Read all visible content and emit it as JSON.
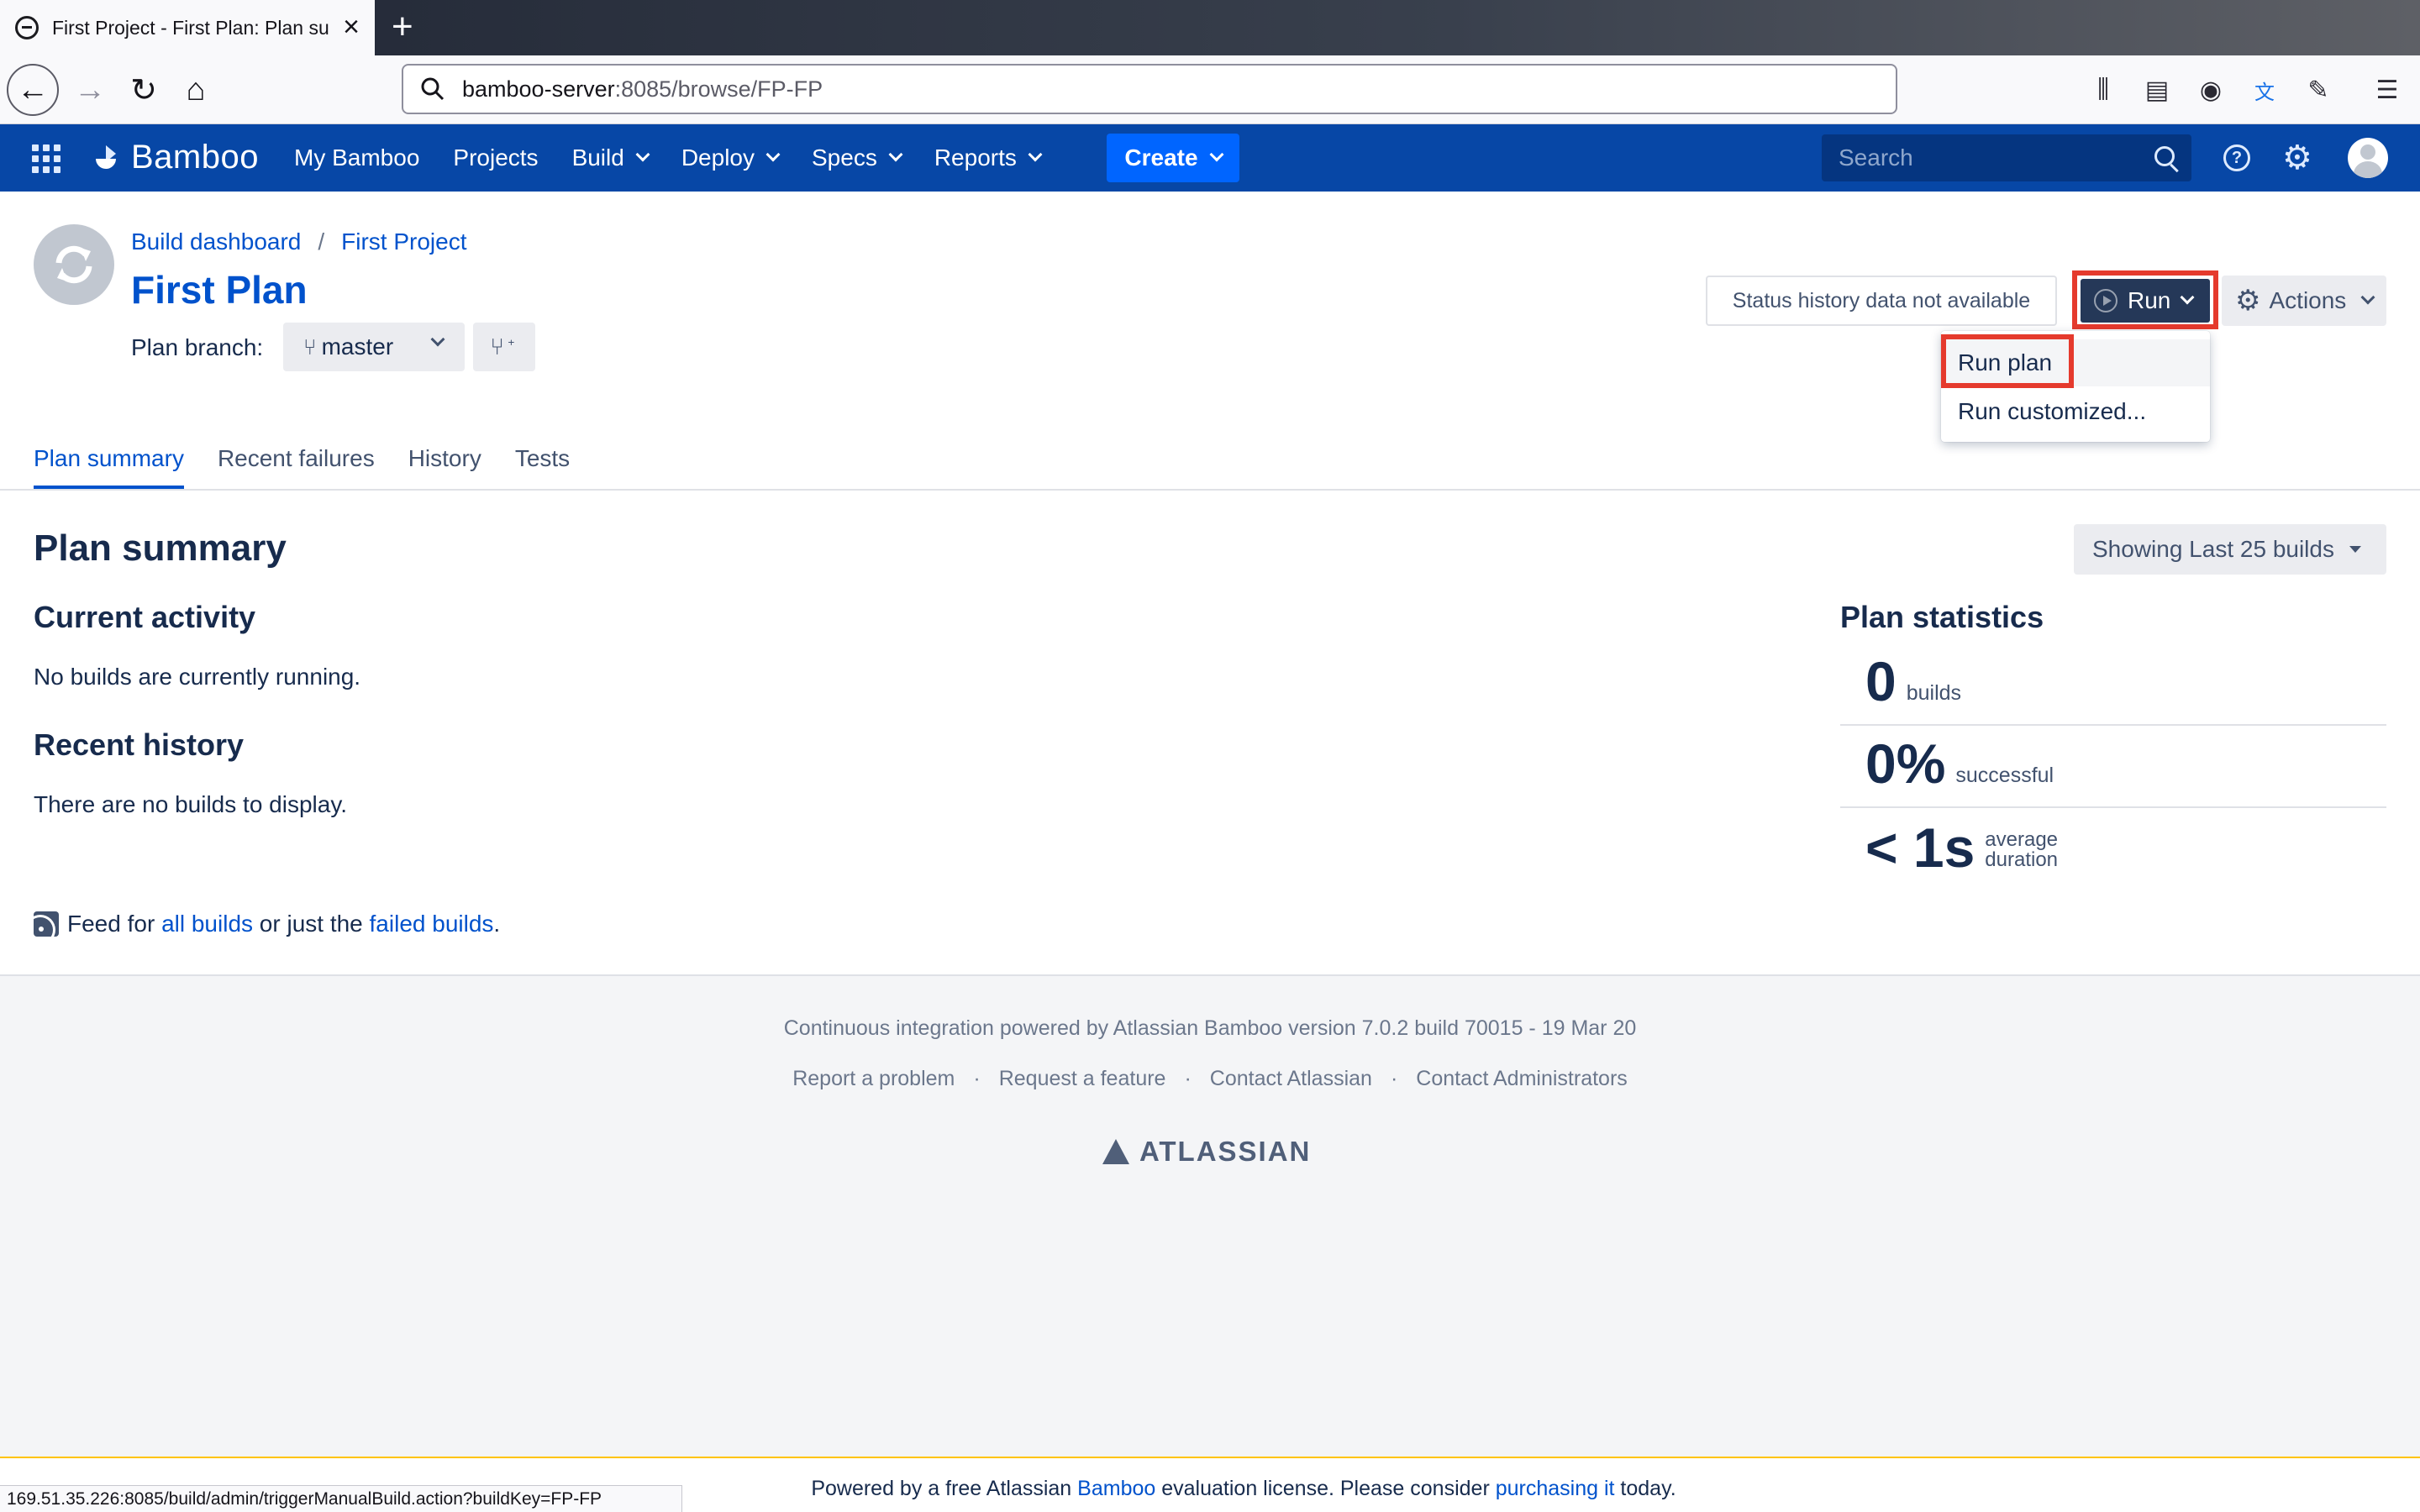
{
  "browser": {
    "tab_title": "First Project - First Plan: Plan summary",
    "url_host": "bamboo-server",
    "url_path": ":8085/browse/FP-FP",
    "status_url": "169.51.35.226:8085/build/admin/triggerManualBuild.action?buildKey=FP-FP"
  },
  "header": {
    "logo": "Bamboo",
    "menu": [
      "My Bamboo",
      "Projects",
      "Build",
      "Deploy",
      "Specs",
      "Reports"
    ],
    "create": "Create",
    "search_placeholder": "Search"
  },
  "page": {
    "breadcrumb": [
      "Build dashboard",
      "First Project"
    ],
    "title": "First Plan",
    "branch_label": "Plan branch:",
    "branch": "master",
    "status_history": "Status history data not available",
    "run": "Run",
    "actions": "Actions",
    "run_menu": [
      "Run plan",
      "Run customized..."
    ]
  },
  "tabs": [
    "Plan summary",
    "Recent failures",
    "History",
    "Tests"
  ],
  "summary": {
    "heading": "Plan summary",
    "showing": "Showing Last 25 builds",
    "current_activity": "Current activity",
    "no_running": "No builds are currently running.",
    "recent_history": "Recent history",
    "no_builds": "There are no builds to display.",
    "feed_prefix": "Feed for",
    "feed_all": "all builds",
    "feed_mid": "or just the",
    "feed_failed": "failed builds",
    "feed_end": "."
  },
  "statistics": {
    "heading": "Plan statistics",
    "builds_value": "0",
    "builds_label": "builds",
    "success_value": "0%",
    "success_label": "successful",
    "duration_value": "< 1s",
    "duration_label_1": "average",
    "duration_label_2": "duration"
  },
  "footer": {
    "powered": "Continuous integration powered by Atlassian Bamboo version 7.0.2 build 70015 - 19 Mar 20",
    "links": [
      "Report a problem",
      "Request a feature",
      "Contact Atlassian",
      "Contact Administrators"
    ],
    "logo": "ATLASSIAN",
    "separator": "·"
  },
  "license": {
    "prefix": "Powered by a free Atlassian",
    "bamboo": "Bamboo",
    "middle": "evaluation license. Please consider",
    "link": "purchasing it",
    "suffix": "today."
  },
  "colors": {
    "header_bg": "#0747a6",
    "create_bg": "#0065ff",
    "link": "#0052cc",
    "highlight": "#e53a2d"
  }
}
